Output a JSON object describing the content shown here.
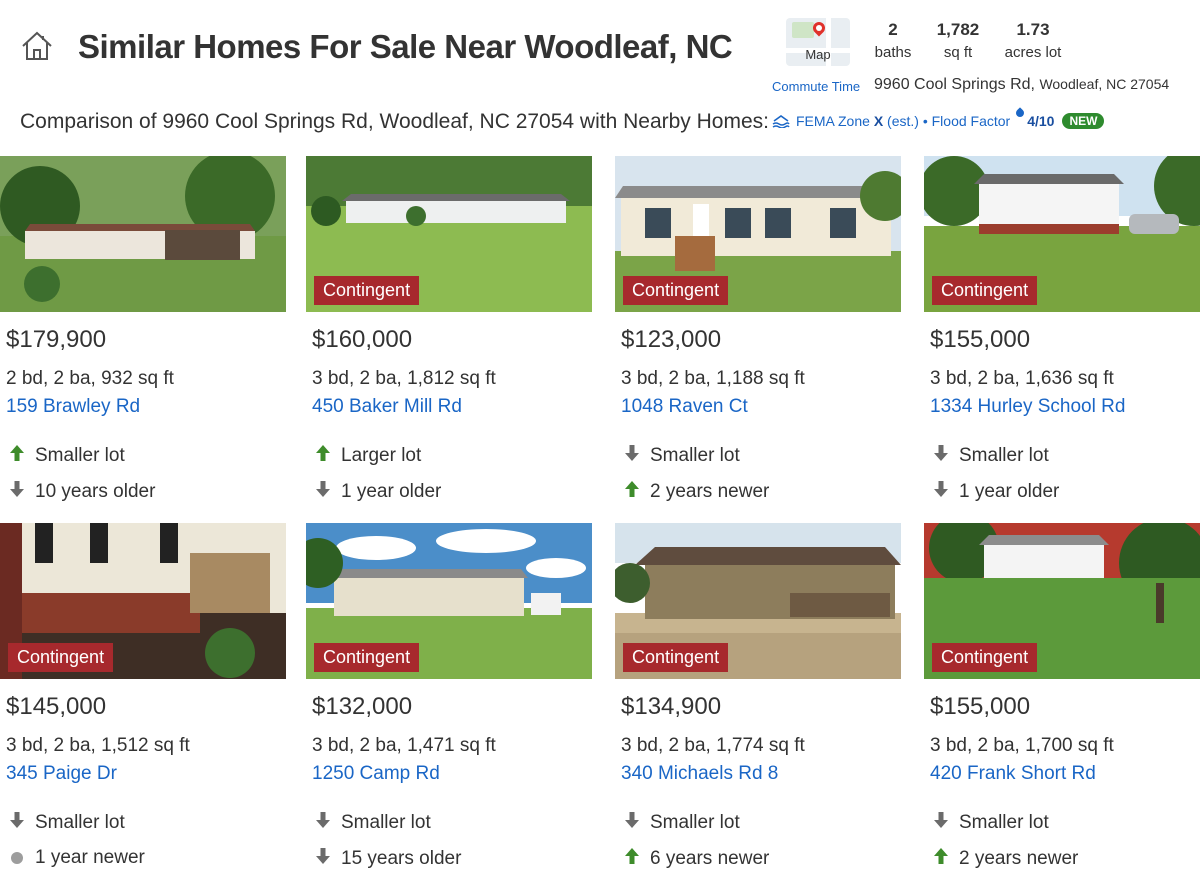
{
  "header": {
    "title": "Similar Homes For Sale Near Woodleaf, NC",
    "subtitle": "Comparison of 9960 Cool Springs Rd, Woodleaf, NC 27054 with Nearby Homes:"
  },
  "property": {
    "map_label": "Map",
    "stats": [
      {
        "value": "2",
        "label": "baths"
      },
      {
        "value": "1,782",
        "label": "sq ft"
      },
      {
        "value": "1.73",
        "label": "acres lot"
      }
    ],
    "commute_label": "Commute Time",
    "street": "9960 Cool Springs Rd,",
    "city": "Woodleaf, NC 27054",
    "fema_prefix": "FEMA Zone",
    "fema_zone": "X",
    "fema_suffix": "(est.) • Flood Factor",
    "flood_score": "4/10",
    "new_badge": "NEW"
  },
  "homes": [
    {
      "badge": "",
      "price": "$179,900",
      "details": "2 bd, 2 ba, 932 sq ft",
      "address": "159 Brawley Rd",
      "lot": "Smaller lot",
      "lot_icon": "arrow-up-icon",
      "age": "10 years older",
      "age_icon": "arrow-down-icon"
    },
    {
      "badge": "Contingent",
      "price": "$160,000",
      "details": "3 bd, 2 ba, 1,812 sq ft",
      "address": "450 Baker Mill Rd",
      "lot": "Larger lot",
      "lot_icon": "arrow-up-icon",
      "age": "1 year older",
      "age_icon": "arrow-down-icon"
    },
    {
      "badge": "Contingent",
      "price": "$123,000",
      "details": "3 bd, 2 ba, 1,188 sq ft",
      "address": "1048 Raven Ct",
      "lot": "Smaller lot",
      "lot_icon": "arrow-down-icon",
      "age": "2 years newer",
      "age_icon": "arrow-up-icon"
    },
    {
      "badge": "Contingent",
      "price": "$155,000",
      "details": "3 bd, 2 ba, 1,636 sq ft",
      "address": "1334 Hurley School Rd",
      "lot": "Smaller lot",
      "lot_icon": "arrow-down-icon",
      "age": "1 year older",
      "age_icon": "arrow-down-icon"
    },
    {
      "badge": "Contingent",
      "price": "$145,000",
      "details": "3 bd, 2 ba, 1,512 sq ft",
      "address": "345 Paige Dr",
      "lot": "Smaller lot",
      "lot_icon": "arrow-down-icon",
      "age": "1 year newer",
      "age_icon": "dot-icon"
    },
    {
      "badge": "Contingent",
      "price": "$132,000",
      "details": "3 bd, 2 ba, 1,471 sq ft",
      "address": "1250 Camp Rd",
      "lot": "Smaller lot",
      "lot_icon": "arrow-down-icon",
      "age": "15 years older",
      "age_icon": "arrow-down-icon"
    },
    {
      "badge": "Contingent",
      "price": "$134,900",
      "details": "3 bd, 2 ba, 1,774 sq ft",
      "address": "340 Michaels Rd 8",
      "lot": "Smaller lot",
      "lot_icon": "arrow-down-icon",
      "age": "6 years newer",
      "age_icon": "arrow-up-icon"
    },
    {
      "badge": "Contingent",
      "price": "$155,000",
      "details": "3 bd, 2 ba, 1,700 sq ft",
      "address": "420 Frank Short Rd",
      "lot": "Smaller lot",
      "lot_icon": "arrow-down-icon",
      "age": "2 years newer",
      "age_icon": "arrow-up-icon"
    }
  ],
  "colors": {
    "badge": "#a7292d",
    "link": "#1a66c6",
    "arrow_up": "#3e8c2b",
    "arrow_down": "#6b6b6b"
  }
}
